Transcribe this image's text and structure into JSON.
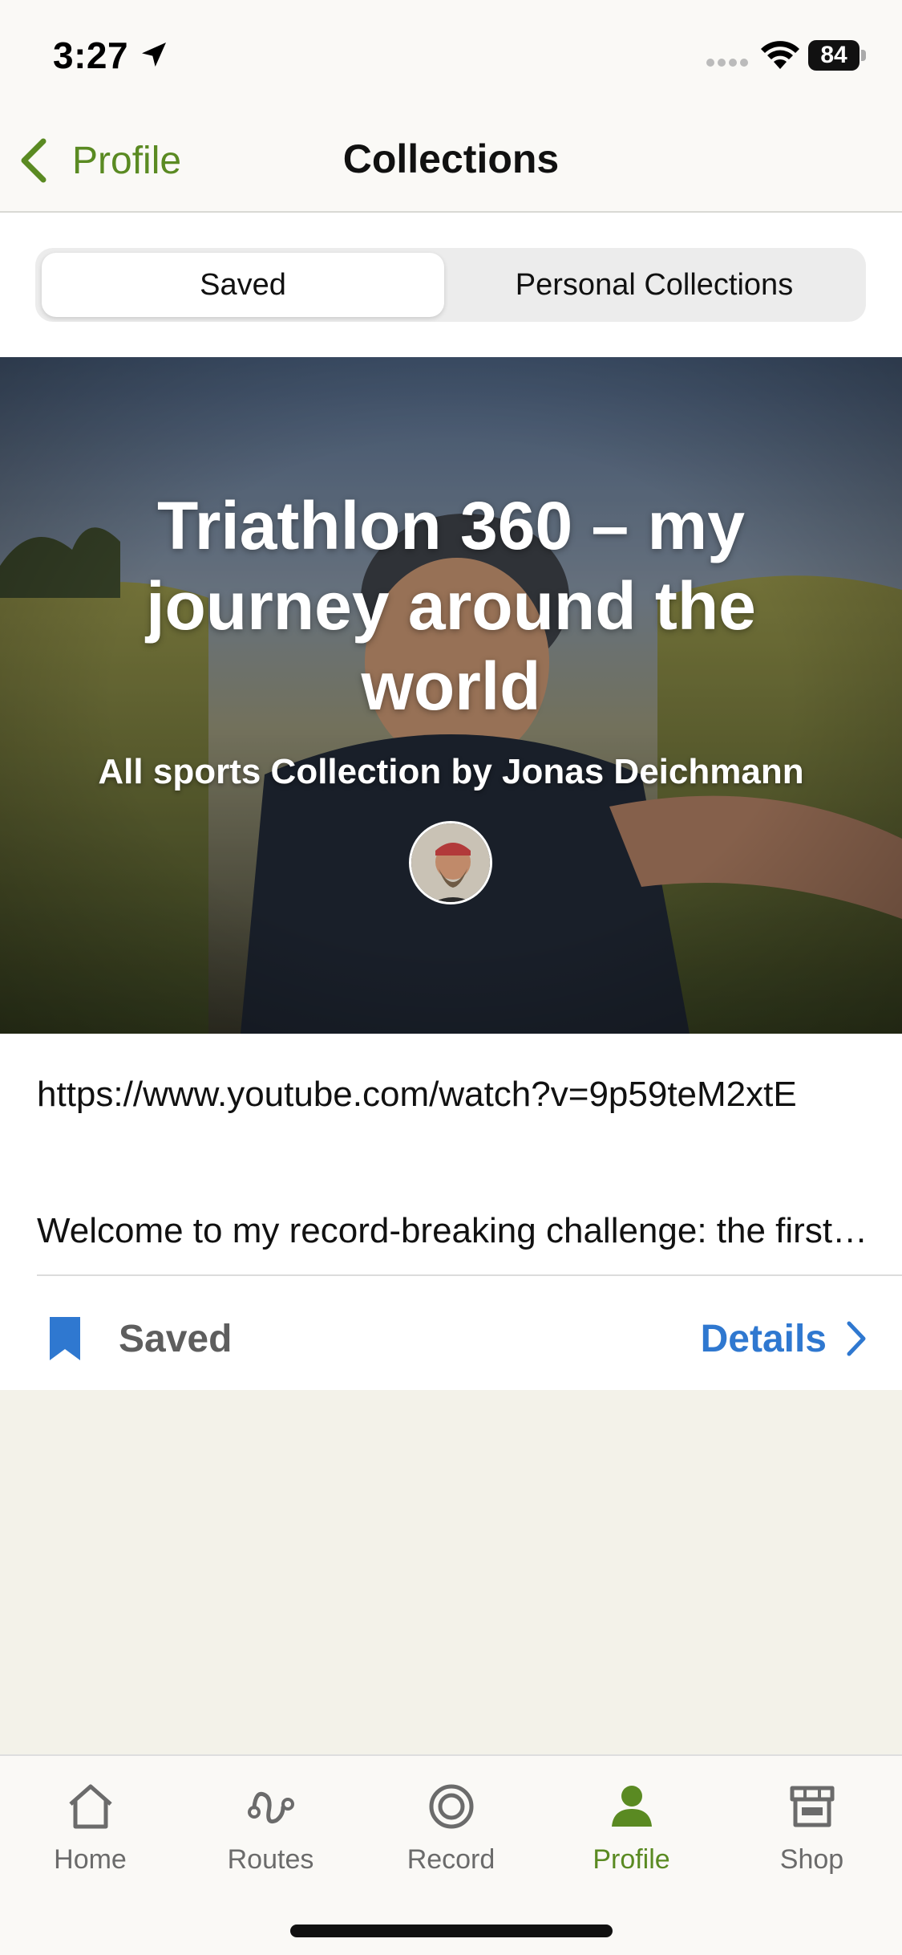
{
  "status_bar": {
    "time": "3:27",
    "battery": "84"
  },
  "nav": {
    "back_label": "Profile",
    "title": "Collections"
  },
  "segments": {
    "saved": "Saved",
    "personal": "Personal Collections",
    "selected": "Saved"
  },
  "collection": {
    "title": "Triathlon 360 – my journey around the world",
    "subtitle": "All sports Collection by Jonas Deichmann",
    "url": "https://www.youtube.com/watch?v=9p59teM2xtE",
    "description": "Welcome to my record-breaking challenge: the first triathlon around the world",
    "saved_label": "Saved",
    "details_label": "Details"
  },
  "tabs": [
    {
      "label": "Home",
      "icon": "home-icon"
    },
    {
      "label": "Routes",
      "icon": "routes-icon"
    },
    {
      "label": "Record",
      "icon": "record-icon"
    },
    {
      "label": "Profile",
      "icon": "profile-icon",
      "active": true
    },
    {
      "label": "Shop",
      "icon": "shop-icon"
    }
  ],
  "colors": {
    "accent_green": "#5a8a22",
    "link_blue": "#2f78d0",
    "background": "#f3f2e9"
  }
}
